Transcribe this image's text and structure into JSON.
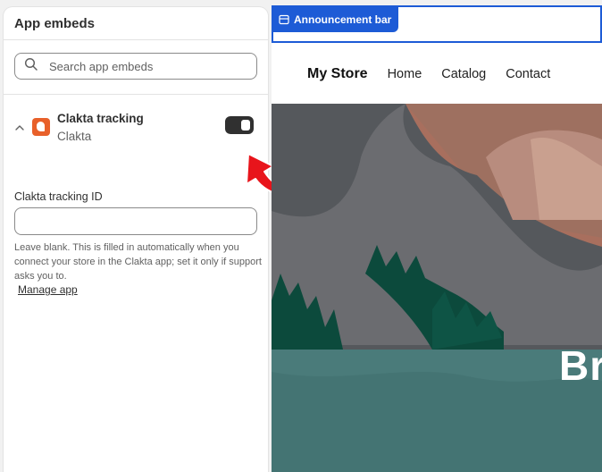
{
  "panel": {
    "title": "App embeds",
    "search": {
      "placeholder": "Search app embeds"
    },
    "embed": {
      "name": "Clakta tracking",
      "vendor": "Clakta",
      "enabled": true,
      "field_label": "Clakta tracking ID",
      "field_value": "",
      "help": "Leave blank. This is filled in automatically when you connect your store in the Clakta app; set it only if support asks you to.",
      "manage_link": "Manage app"
    }
  },
  "preview": {
    "announcement_tag": "Announcement bar",
    "store_name": "My Store",
    "nav": [
      "Home",
      "Catalog",
      "Contact"
    ],
    "hero_text": "Br"
  },
  "colors": {
    "accent": "#1d5bd6",
    "toggle_on": "#303030",
    "app_icon": "#e8602a",
    "arrow": "#e8141b"
  }
}
